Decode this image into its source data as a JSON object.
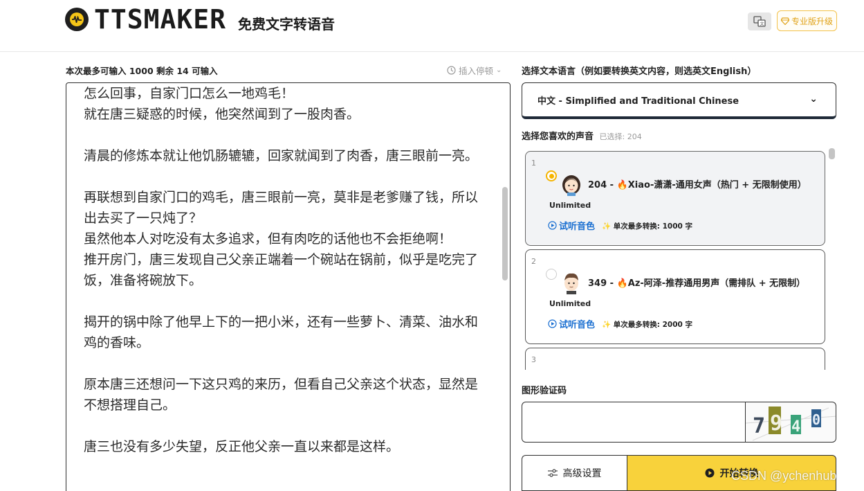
{
  "header": {
    "logo_text": "TTSMAKER",
    "subtitle": "免费文字转语音",
    "pro_label": "专业版升级"
  },
  "editor": {
    "limit_info": "本次最多可输入 1000 剩余 14 可输入",
    "pause_label": "插入停顿",
    "content": "怎么回事，自家门口怎么一地鸡毛！\n就在唐三疑惑的时候，他突然闻到了一股肉香。\n\n清晨的修炼本就让他饥肠辘辘，回家就闻到了肉香，唐三眼前一亮。\n\n再联想到自家门口的鸡毛，唐三眼前一亮，莫非是老爹赚了钱，所以出去买了一只炖了？\n虽然他本人对吃没有太多追求，但有肉吃的话他也不会拒绝啊！\n推开房门，唐三发现自己父亲正端着一个碗站在锅前，似乎是吃完了饭，准备将碗放下。\n\n揭开的锅中除了他早上下的一把小米，还有一些萝卜、清菜、油水和鸡的香味。\n\n原本唐三还想问一下这只鸡的来历，但看自己父亲这个状态，显然是不想搭理自己。\n\n唐三也没有多少失望，反正他父亲一直以来都是这样。"
  },
  "language": {
    "label": "选择文本语言（例如要转换英文内容，则选英文English）",
    "selected": "中文 - Simplified and Traditional Chinese"
  },
  "voices": {
    "label": "选择您喜欢的声音",
    "selected_info": "已选择: 204",
    "items": [
      {
        "index": "1",
        "name": "204 - 🔥Xiao-潇潇-通用女声（热门 + 无限制使用）",
        "badge": "Unlimited",
        "play": "试听音色",
        "max": "单次最多转换: 1000 字",
        "selected": true
      },
      {
        "index": "2",
        "name": "349 - 🔥Az-阿泽-推荐通用男声（需排队 + 无限制）",
        "badge": "Unlimited",
        "play": "试听音色",
        "max": "单次最多转换: 2000 字",
        "selected": false
      },
      {
        "index": "3",
        "name": "",
        "badge": "",
        "play": "",
        "max": "",
        "selected": false
      }
    ]
  },
  "captcha": {
    "label": "图形验证码",
    "value": "",
    "chars": [
      "7",
      "9",
      "4",
      "0"
    ]
  },
  "actions": {
    "advanced": "高级设置",
    "start": "开始转换"
  },
  "watermark": "CSDN @ychenhub",
  "colors": {
    "accent": "#f8d23b",
    "radio_on": "#f5b400",
    "link": "#1a6fd1"
  }
}
